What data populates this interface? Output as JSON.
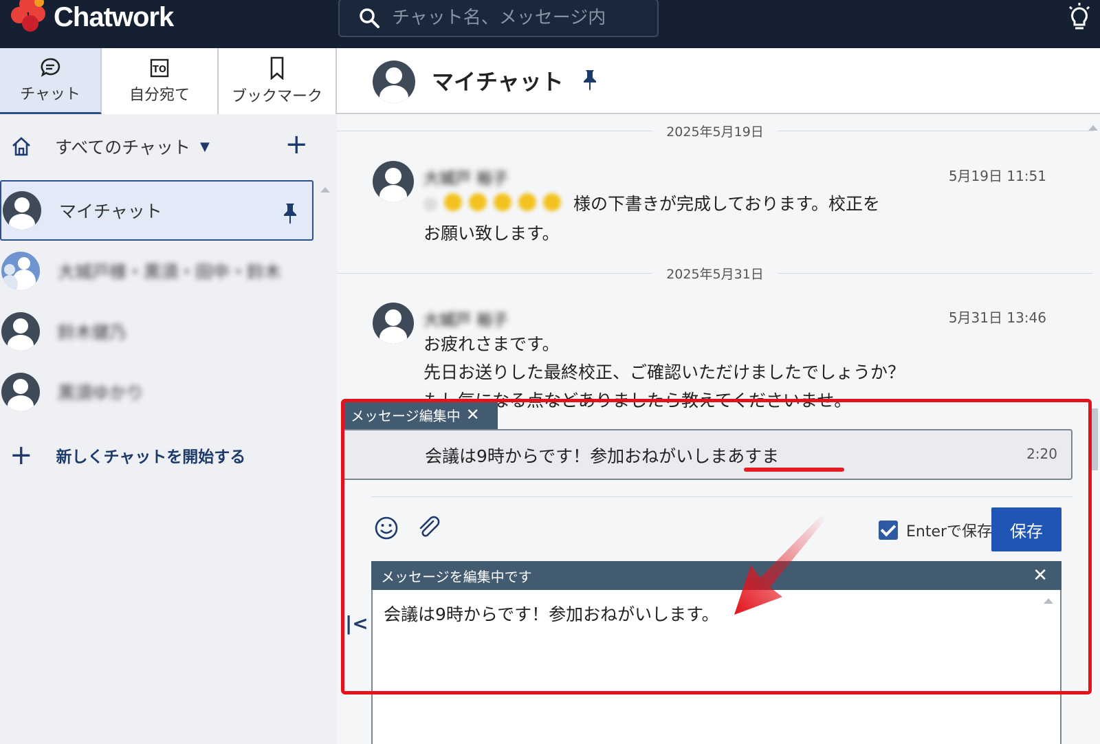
{
  "app": {
    "name": "Chatwork",
    "search_placeholder": "チャット名、メッセージ内"
  },
  "tabs": [
    {
      "label": "チャット",
      "icon": "chat-bubble-icon",
      "active": true
    },
    {
      "label": "自分宛て",
      "icon": "to-icon",
      "active": false
    },
    {
      "label": "ブックマーク",
      "icon": "bookmark-icon",
      "active": false
    }
  ],
  "sidebar": {
    "filter_label": "すべてのチャット",
    "rooms": [
      {
        "name": "マイチャット",
        "active": true,
        "pinned": true
      },
      {
        "name": "大城戸様・黒須・田中・鈴木",
        "blurred": true
      },
      {
        "name": "鈴木健乃",
        "blurred": true
      },
      {
        "name": "黒須ゆかり",
        "blurred": true
      }
    ],
    "new_chat_label": "新しくチャットを開始する"
  },
  "chat": {
    "title": "マイチャット",
    "dates": [
      "2025年5月19日",
      "2025年5月31日"
    ],
    "messages": [
      {
        "sender": "大城戸 裕子",
        "time": "5月19日 11:51",
        "line1": "様の下書きが完成しております。校正を",
        "line2": "お願い致します。"
      },
      {
        "sender": "大城戸 裕子",
        "time": "5月31日 13:46",
        "line1": "お疲れさまです。",
        "line2": "先日お送りした最終校正、ご確認いただけましたでしょうか？",
        "line3": "もし気になる点などありましたら教えてくださいませ。"
      }
    ]
  },
  "editing": {
    "tag_label": "メッセージ編集中",
    "original_text": "会議は9時からです！参加おねがいしまあすま",
    "original_time": "2:20",
    "enter_save_label": "Enterで保存",
    "enter_save_checked": true,
    "save_button_label": "保存",
    "bar_label": "メッセージを編集中です",
    "editor_value": "会議は9時からです！参加おねがいします。"
  },
  "colors": {
    "topbar": "#152133",
    "accent": "#1f55b5",
    "highlight": "#e3121b",
    "edit_bar": "#435b71"
  }
}
